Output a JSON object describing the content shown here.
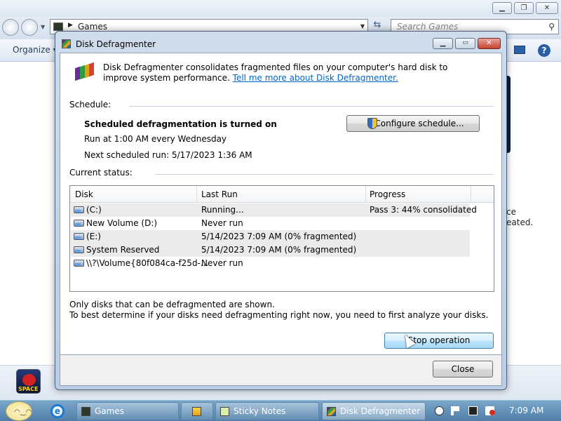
{
  "explorer": {
    "address": "Games",
    "search_placeholder": "Search Games",
    "organize_label": "Organize ▾",
    "snippet_line1": "ce",
    "snippet_line2": "eated.",
    "game_thumb_label": "SPACE"
  },
  "dialog": {
    "title": "Disk Defragmenter",
    "intro_text": "Disk Defragmenter consolidates fragmented files on your computer's hard disk to improve system performance.",
    "learn_more_link": "Tell me more about Disk Defragmenter.",
    "schedule_label": "Schedule:",
    "schedule_status": "Scheduled defragmentation is turned on",
    "schedule_run": "Run at 1:00 AM every Wednesday",
    "next_run": "Next scheduled run: 5/17/2023 1:36 AM",
    "configure_button": "Configure schedule...",
    "current_status_label": "Current status:",
    "columns": {
      "disk": "Disk",
      "last_run": "Last Run",
      "progress": "Progress"
    },
    "disks": [
      {
        "disk": "(C:)",
        "last_run": "Running...",
        "progress": "Pass 3: 44% consolidated"
      },
      {
        "disk": "New Volume (D:)",
        "last_run": "Never run",
        "progress": ""
      },
      {
        "disk": "(E:)",
        "last_run": "5/14/2023 7:09 AM (0% fragmented)",
        "progress": ""
      },
      {
        "disk": "System Reserved",
        "last_run": "5/14/2023 7:09 AM (0% fragmented)",
        "progress": ""
      },
      {
        "disk": "\\\\?\\Volume{80f084ca-f25d-...",
        "last_run": "Never run",
        "progress": ""
      }
    ],
    "note_line1": "Only disks that can be defragmented are shown.",
    "note_line2": "To best determine if your disks need defragmenting right now, you need to first analyze your disks.",
    "stop_button": "Stop operation",
    "close_button": "Close"
  },
  "taskbar": {
    "tasks": [
      {
        "label": "Games"
      },
      {
        "label": ""
      },
      {
        "label": "Sticky Notes"
      },
      {
        "label": "Disk Defragmenter"
      }
    ],
    "clock": "7:09 AM"
  }
}
